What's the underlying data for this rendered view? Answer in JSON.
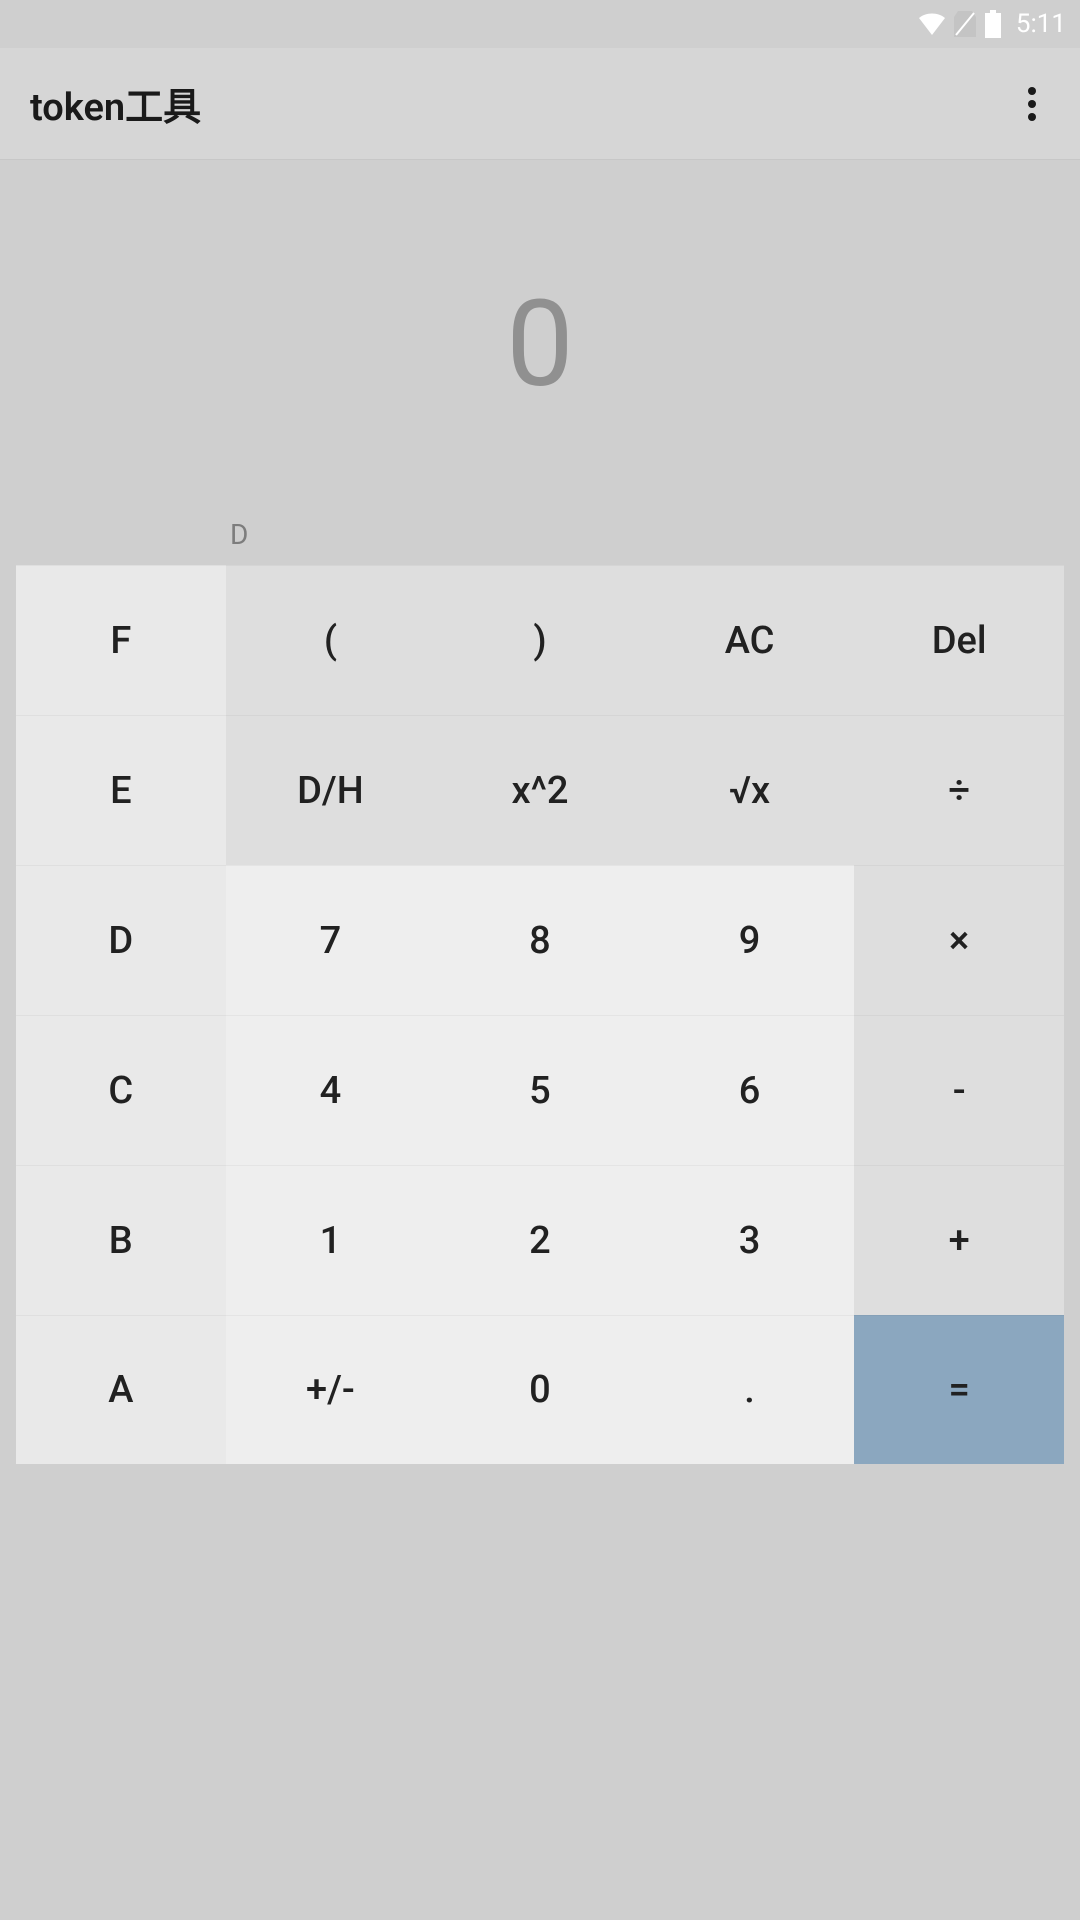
{
  "status": {
    "time": "5:11"
  },
  "appbar": {
    "title": "token工具"
  },
  "display": {
    "value": "0",
    "mode": "D"
  },
  "keys": {
    "r1": {
      "c1": "F",
      "c2": "(",
      "c3": ")",
      "c4": "AC",
      "c5": "Del"
    },
    "r2": {
      "c1": "E",
      "c2": "D/H",
      "c3": "x^2",
      "c4": "√x",
      "c5": "÷"
    },
    "r3": {
      "c1": "D",
      "c2": "7",
      "c3": "8",
      "c4": "9",
      "c5": "×"
    },
    "r4": {
      "c1": "C",
      "c2": "4",
      "c3": "5",
      "c4": "6",
      "c5": "-"
    },
    "r5": {
      "c1": "B",
      "c2": "1",
      "c3": "2",
      "c4": "3",
      "c5": "+"
    },
    "r6": {
      "c1": "A",
      "c2": "+/-",
      "c3": "0",
      "c4": ".",
      "c5": "="
    }
  }
}
